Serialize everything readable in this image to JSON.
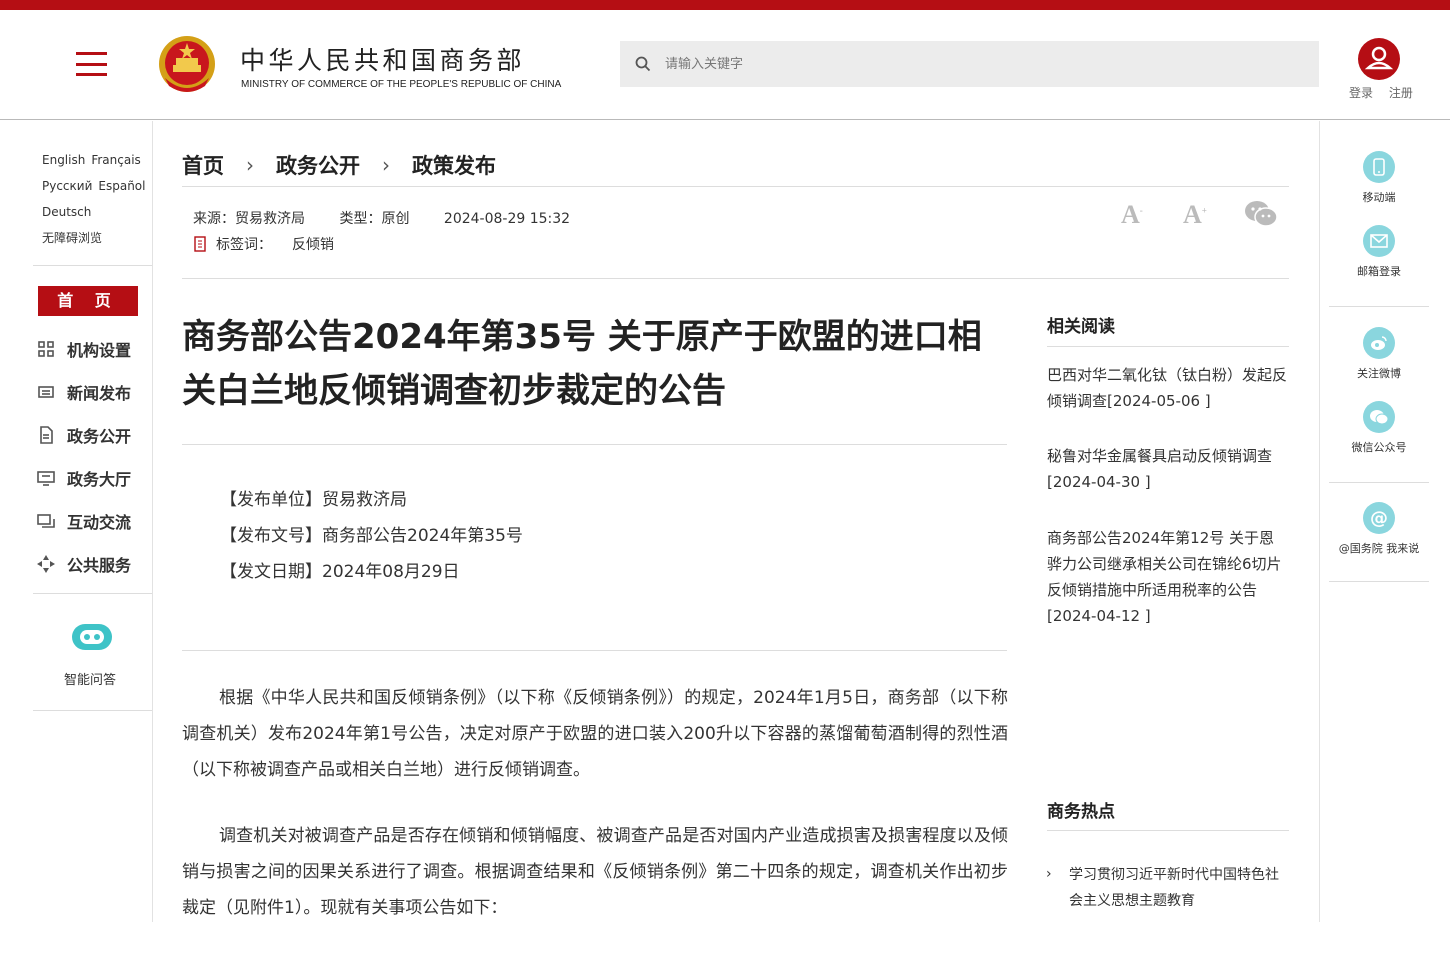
{
  "header": {
    "site_name_cn": "中华人民共和国商务部",
    "site_name_en": "MINISTRY OF COMMERCE OF THE PEOPLE'S REPUBLIC OF CHINA",
    "search_placeholder": "请输入关键字",
    "login": "登录",
    "register": "注册",
    "brand_color": "#b50e14"
  },
  "languages": [
    "English",
    "Français",
    "Русский",
    "Español",
    "Deutsch"
  ],
  "accessibility": "无障碍浏览",
  "left_nav": {
    "home": "首 页",
    "items": [
      {
        "label": "机构设置",
        "icon": "grid-icon"
      },
      {
        "label": "新闻发布",
        "icon": "news-icon"
      },
      {
        "label": "政务公开",
        "icon": "document-icon"
      },
      {
        "label": "政务大厅",
        "icon": "monitor-icon"
      },
      {
        "label": "互动交流",
        "icon": "chat-icon"
      },
      {
        "label": "公共服务",
        "icon": "service-icon"
      }
    ],
    "assistant": "智能问答"
  },
  "breadcrumb": [
    "首页",
    "政务公开",
    "政策发布"
  ],
  "meta": {
    "source": "来源：贸易救济局",
    "type": "类型：原创",
    "datetime": "2024-08-29 15:32",
    "tag_label": "标签词：",
    "tag": "反倾销"
  },
  "font_controls": {
    "decrease": "A",
    "increase": "A"
  },
  "article": {
    "title": "商务部公告2024年第35号 关于原产于欧盟的进口相关白兰地反倾销调查初步裁定的公告",
    "info": [
      "【发布单位】贸易救济局",
      "【发布文号】商务部公告2024年第35号",
      "【发文日期】2024年08月29日"
    ],
    "paragraphs": [
      "根据《中华人民共和国反倾销条例》（以下称《反倾销条例》）的规定，2024年1月5日，商务部（以下称调查机关）发布2024年第1号公告，决定对原产于欧盟的进口装入200升以下容器的蒸馏葡萄酒制得的烈性酒（以下称被调查产品或相关白兰地）进行反倾销调查。",
      "调查机关对被调查产品是否存在倾销和倾销幅度、被调查产品是否对国内产业造成损害及损害程度以及倾销与损害之间的因果关系进行了调查。根据调查结果和《反倾销条例》第二十四条的规定，调查机关作出初步裁定（见附件1）。现就有关事项公告如下："
    ]
  },
  "related": {
    "heading": "相关阅读",
    "items": [
      "巴西对华二氧化钛（钛白粉）发起反倾销调查[2024-05-06 ]",
      "秘鲁对华金属餐具启动反倾销调查[2024-04-30 ]",
      "商务部公告2024年第12号 关于恩骅力公司继承相关公司在锦纶6切片反倾销措施中所适用税率的公告[2024-04-12 ]"
    ]
  },
  "hot": {
    "heading": "商务热点",
    "items": [
      "学习贯彻习近平新时代中国特色社会主义思想主题教育"
    ]
  },
  "right_bar": {
    "items": [
      "移动端",
      "邮箱登录",
      "关注微博",
      "微信公众号",
      "@国务院 我来说"
    ]
  }
}
